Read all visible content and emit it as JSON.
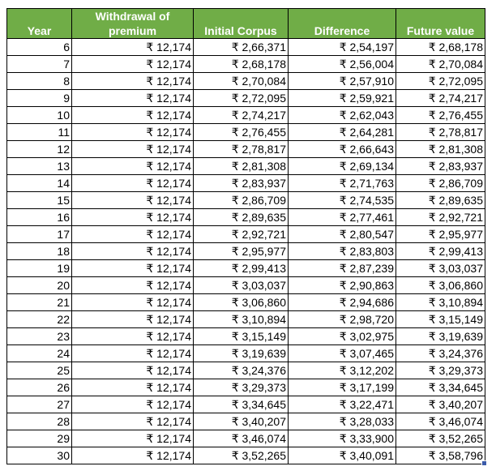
{
  "table": {
    "headers": {
      "year": "Year",
      "withdrawal": "Withdrawal of premium",
      "initial_corpus": "Initial Corpus",
      "difference": "Difference",
      "future_value": "Future value"
    },
    "header_color": "#70ad47",
    "rows": [
      {
        "year": "6",
        "withdrawal": "₹ 12,174",
        "initial_corpus": "₹ 2,66,371",
        "difference": "₹ 2,54,197",
        "future_value": "₹ 2,68,178"
      },
      {
        "year": "7",
        "withdrawal": "₹ 12,174",
        "initial_corpus": "₹ 2,68,178",
        "difference": "₹ 2,56,004",
        "future_value": "₹ 2,70,084"
      },
      {
        "year": "8",
        "withdrawal": "₹ 12,174",
        "initial_corpus": "₹ 2,70,084",
        "difference": "₹ 2,57,910",
        "future_value": "₹ 2,72,095"
      },
      {
        "year": "9",
        "withdrawal": "₹ 12,174",
        "initial_corpus": "₹ 2,72,095",
        "difference": "₹ 2,59,921",
        "future_value": "₹ 2,74,217"
      },
      {
        "year": "10",
        "withdrawal": "₹ 12,174",
        "initial_corpus": "₹ 2,74,217",
        "difference": "₹ 2,62,043",
        "future_value": "₹ 2,76,455"
      },
      {
        "year": "11",
        "withdrawal": "₹ 12,174",
        "initial_corpus": "₹ 2,76,455",
        "difference": "₹ 2,64,281",
        "future_value": "₹ 2,78,817"
      },
      {
        "year": "12",
        "withdrawal": "₹ 12,174",
        "initial_corpus": "₹ 2,78,817",
        "difference": "₹ 2,66,643",
        "future_value": "₹ 2,81,308"
      },
      {
        "year": "13",
        "withdrawal": "₹ 12,174",
        "initial_corpus": "₹ 2,81,308",
        "difference": "₹ 2,69,134",
        "future_value": "₹ 2,83,937"
      },
      {
        "year": "14",
        "withdrawal": "₹ 12,174",
        "initial_corpus": "₹ 2,83,937",
        "difference": "₹ 2,71,763",
        "future_value": "₹ 2,86,709"
      },
      {
        "year": "15",
        "withdrawal": "₹ 12,174",
        "initial_corpus": "₹ 2,86,709",
        "difference": "₹ 2,74,535",
        "future_value": "₹ 2,89,635"
      },
      {
        "year": "16",
        "withdrawal": "₹ 12,174",
        "initial_corpus": "₹ 2,89,635",
        "difference": "₹ 2,77,461",
        "future_value": "₹ 2,92,721"
      },
      {
        "year": "17",
        "withdrawal": "₹ 12,174",
        "initial_corpus": "₹ 2,92,721",
        "difference": "₹ 2,80,547",
        "future_value": "₹ 2,95,977"
      },
      {
        "year": "18",
        "withdrawal": "₹ 12,174",
        "initial_corpus": "₹ 2,95,977",
        "difference": "₹ 2,83,803",
        "future_value": "₹ 2,99,413"
      },
      {
        "year": "19",
        "withdrawal": "₹ 12,174",
        "initial_corpus": "₹ 2,99,413",
        "difference": "₹ 2,87,239",
        "future_value": "₹ 3,03,037"
      },
      {
        "year": "20",
        "withdrawal": "₹ 12,174",
        "initial_corpus": "₹ 3,03,037",
        "difference": "₹ 2,90,863",
        "future_value": "₹ 3,06,860"
      },
      {
        "year": "21",
        "withdrawal": "₹ 12,174",
        "initial_corpus": "₹ 3,06,860",
        "difference": "₹ 2,94,686",
        "future_value": "₹ 3,10,894"
      },
      {
        "year": "22",
        "withdrawal": "₹ 12,174",
        "initial_corpus": "₹ 3,10,894",
        "difference": "₹ 2,98,720",
        "future_value": "₹ 3,15,149"
      },
      {
        "year": "23",
        "withdrawal": "₹ 12,174",
        "initial_corpus": "₹ 3,15,149",
        "difference": "₹ 3,02,975",
        "future_value": "₹ 3,19,639"
      },
      {
        "year": "24",
        "withdrawal": "₹ 12,174",
        "initial_corpus": "₹ 3,19,639",
        "difference": "₹ 3,07,465",
        "future_value": "₹ 3,24,376"
      },
      {
        "year": "25",
        "withdrawal": "₹ 12,174",
        "initial_corpus": "₹ 3,24,376",
        "difference": "₹ 3,12,202",
        "future_value": "₹ 3,29,373"
      },
      {
        "year": "26",
        "withdrawal": "₹ 12,174",
        "initial_corpus": "₹ 3,29,373",
        "difference": "₹ 3,17,199",
        "future_value": "₹ 3,34,645"
      },
      {
        "year": "27",
        "withdrawal": "₹ 12,174",
        "initial_corpus": "₹ 3,34,645",
        "difference": "₹ 3,22,471",
        "future_value": "₹ 3,40,207"
      },
      {
        "year": "28",
        "withdrawal": "₹ 12,174",
        "initial_corpus": "₹ 3,40,207",
        "difference": "₹ 3,28,033",
        "future_value": "₹ 3,46,074"
      },
      {
        "year": "29",
        "withdrawal": "₹ 12,174",
        "initial_corpus": "₹ 3,46,074",
        "difference": "₹ 3,33,900",
        "future_value": "₹ 3,52,265"
      },
      {
        "year": "30",
        "withdrawal": "₹ 12,174",
        "initial_corpus": "₹ 3,52,265",
        "difference": "₹ 3,40,091",
        "future_value": "₹ 3,58,796"
      }
    ]
  }
}
